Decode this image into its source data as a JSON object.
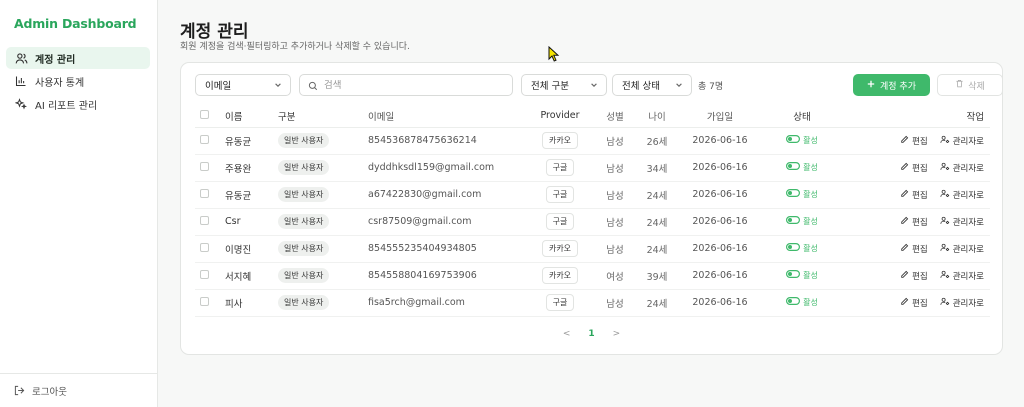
{
  "sidebar": {
    "brand": "Admin Dashboard",
    "items": [
      {
        "label": "계정 관리",
        "icon": "users-icon",
        "active": true
      },
      {
        "label": "사용자 통계",
        "icon": "bar-chart-icon",
        "active": false
      },
      {
        "label": "AI 리포트 관리",
        "icon": "sparkles-icon",
        "active": false
      }
    ],
    "logout_label": "로그아웃"
  },
  "header": {
    "title": "계정 관리",
    "subtitle": "회원 계정을 검색·필터링하고 추가하거나 삭제할 수 있습니다."
  },
  "toolbar": {
    "field_select": "이메일",
    "search_placeholder": "검색",
    "type_filter": "전체 구분",
    "status_filter": "전체 상태",
    "count": "총 7명",
    "add_label": "계정 추가",
    "delete_label": "삭제"
  },
  "table": {
    "columns": [
      "이름",
      "구분",
      "이메일",
      "Provider",
      "성별",
      "나이",
      "가입일",
      "상태",
      "작업"
    ],
    "rows": [
      {
        "name": "유동균",
        "type": "일반 사용자",
        "email": "854536878475636214",
        "provider": "카카오",
        "sex": "남성",
        "age": "26세",
        "joined": "2026-06-16",
        "status": "활성"
      },
      {
        "name": "주용완",
        "type": "일반 사용자",
        "email": "dyddhksdl159@gmail.com",
        "provider": "구글",
        "sex": "남성",
        "age": "34세",
        "joined": "2026-06-16",
        "status": "활성"
      },
      {
        "name": "유동균",
        "type": "일반 사용자",
        "email": "a67422830@gmail.com",
        "provider": "구글",
        "sex": "남성",
        "age": "24세",
        "joined": "2026-06-16",
        "status": "활성"
      },
      {
        "name": "Csr",
        "type": "일반 사용자",
        "email": "csr87509@gmail.com",
        "provider": "구글",
        "sex": "남성",
        "age": "24세",
        "joined": "2026-06-16",
        "status": "활성"
      },
      {
        "name": "이명진",
        "type": "일반 사용자",
        "email": "854555235404934805",
        "provider": "카카오",
        "sex": "남성",
        "age": "24세",
        "joined": "2026-06-16",
        "status": "활성"
      },
      {
        "name": "서지혜",
        "type": "일반 사용자",
        "email": "854558804169753906",
        "provider": "카카오",
        "sex": "여성",
        "age": "39세",
        "joined": "2026-06-16",
        "status": "활성"
      },
      {
        "name": "피사",
        "type": "일반 사용자",
        "email": "fisa5rch@gmail.com",
        "provider": "구글",
        "sex": "남성",
        "age": "24세",
        "joined": "2026-06-16",
        "status": "활성"
      }
    ],
    "edit_label": "편집",
    "admin_label": "관리자로"
  },
  "pagination": {
    "prev": "<",
    "current": "1",
    "next": ">"
  },
  "colors": {
    "accent": "#3fb96b",
    "brand": "#2aa65c",
    "active_bg": "#e9f6ee"
  }
}
